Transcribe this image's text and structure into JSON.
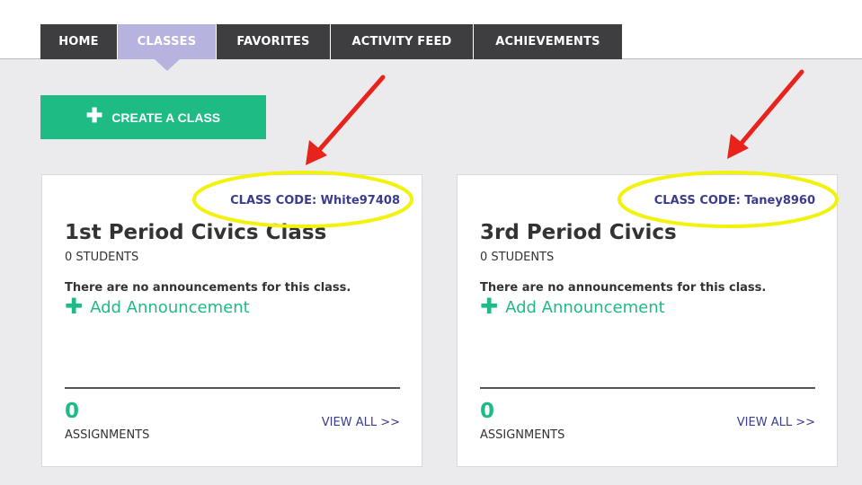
{
  "nav": {
    "tabs": [
      {
        "label": "HOME"
      },
      {
        "label": "CLASSES"
      },
      {
        "label": "FAVORITES"
      },
      {
        "label": "ACTIVITY FEED"
      },
      {
        "label": "ACHIEVEMENTS"
      }
    ],
    "active_tab": "CLASSES"
  },
  "create_button": {
    "icon": "plus-icon",
    "label": "CREATE A CLASS"
  },
  "classes": [
    {
      "code_text": "CLASS CODE: White97408",
      "name": "1st Period Civics Class",
      "students": "0 STUDENTS",
      "announcements_text": "There are no announcements for this class.",
      "add_announcement": "Add Announcement",
      "assignment_count": "0",
      "assignment_label": "ASSIGNMENTS",
      "view_all": "VIEW ALL >>"
    },
    {
      "code_text": "CLASS CODE: Taney8960",
      "name": "3rd Period Civics",
      "students": "0 STUDENTS",
      "announcements_text": "There are no announcements for this class.",
      "add_announcement": "Add Announcement",
      "assignment_count": "0",
      "assignment_label": "ASSIGNMENTS",
      "view_all": "VIEW ALL >>"
    }
  ],
  "annotations": {
    "arrow_color": "#e8231c",
    "highlight_color": "#f2f20c"
  },
  "colors": {
    "accent_green": "#1fbb85",
    "active_tab": "#b7b3df",
    "tab_dark": "#3e3e40",
    "link_blue": "#3a3c8e"
  }
}
